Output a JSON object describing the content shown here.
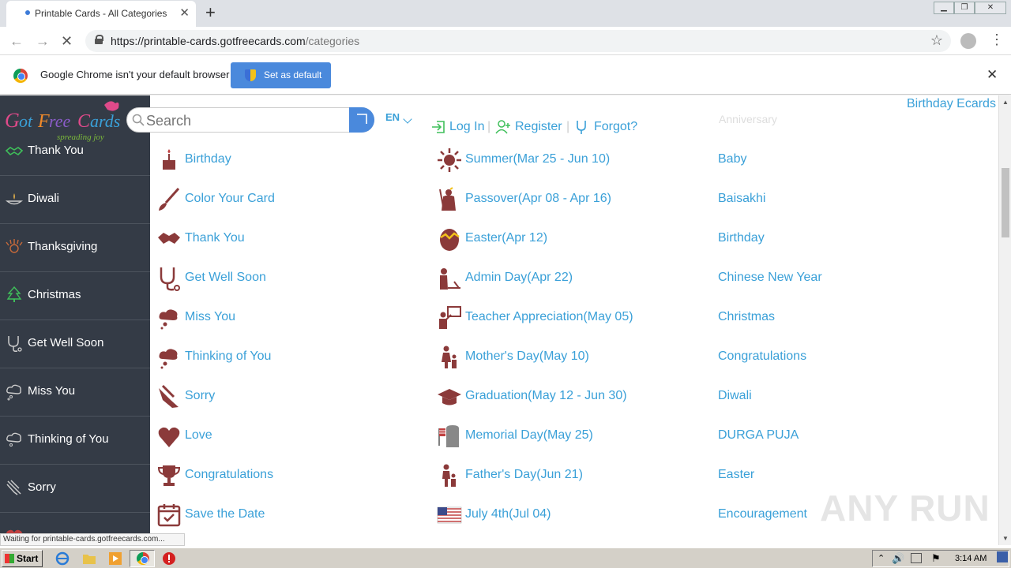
{
  "browser": {
    "tab_title": "Printable Cards - All Categories",
    "url_domain": "https://printable-cards.gotfreecards.com",
    "url_path": "/categories",
    "infobar_text": "Google Chrome isn't your default browser",
    "set_default_label": "Set as default"
  },
  "header": {
    "search_placeholder": "Search",
    "lang": "EN",
    "login": "Log In",
    "register": "Register",
    "forgot": "Forgot?",
    "ecards_link": "Birthday Ecards",
    "faded_top": "Anniversary"
  },
  "sidebar": {
    "items": [
      {
        "label": "Thank You",
        "icon": "handshake-icon"
      },
      {
        "label": "Diwali",
        "icon": "diya-icon"
      },
      {
        "label": "Thanksgiving",
        "icon": "turkey-icon"
      },
      {
        "label": "Christmas",
        "icon": "tree-icon"
      },
      {
        "label": "Get Well Soon",
        "icon": "stethoscope-icon"
      },
      {
        "label": "Miss You",
        "icon": "cloud-icon"
      },
      {
        "label": "Thinking of You",
        "icon": "thought-icon"
      },
      {
        "label": "Sorry",
        "icon": "praying-hands-icon"
      }
    ]
  },
  "col1": [
    {
      "label": "Birthday",
      "icon": "cake-icon"
    },
    {
      "label": "Color Your Card",
      "icon": "brush-icon"
    },
    {
      "label": "Thank You",
      "icon": "handshake-icon"
    },
    {
      "label": "Get Well Soon",
      "icon": "stethoscope-icon"
    },
    {
      "label": "Miss You",
      "icon": "cloud-icon"
    },
    {
      "label": "Thinking of You",
      "icon": "thought-icon"
    },
    {
      "label": "Sorry",
      "icon": "praying-hands-icon"
    },
    {
      "label": "Love",
      "icon": "heart-icon"
    },
    {
      "label": "Congratulations",
      "icon": "trophy-icon"
    },
    {
      "label": "Save the Date",
      "icon": "calendar-icon"
    }
  ],
  "col2": [
    {
      "label": "Summer(Mar 25 - Jun 10)",
      "icon": "sun-icon"
    },
    {
      "label": "Passover(Apr 08 - Apr 16)",
      "icon": "moses-icon"
    },
    {
      "label": "Easter(Apr 12)",
      "icon": "egg-icon"
    },
    {
      "label": "Admin Day(Apr 22)",
      "icon": "admin-icon"
    },
    {
      "label": "Teacher Appreciation(May 05)",
      "icon": "teacher-icon"
    },
    {
      "label": "Mother's Day(May 10)",
      "icon": "mother-icon"
    },
    {
      "label": "Graduation(May 12 - Jun 30)",
      "icon": "graduation-cap-icon"
    },
    {
      "label": "Memorial Day(May 25)",
      "icon": "memorial-icon"
    },
    {
      "label": "Father's Day(Jun 21)",
      "icon": "father-icon"
    },
    {
      "label": "July 4th(Jul 04)",
      "icon": "us-flag-icon"
    }
  ],
  "col3": [
    "Baby",
    "Baisakhi",
    "Birthday",
    "Chinese New Year",
    "Christmas",
    "Congratulations",
    "Diwali",
    "DURGA PUJA",
    "Easter",
    "Encouragement"
  ],
  "status_text": "Waiting for printable-cards.gotfreecards.com...",
  "watermark": "ANY RUN",
  "taskbar": {
    "start": "Start",
    "clock": "3:14 AM"
  },
  "colors": {
    "link": "#3aa0d8",
    "icon": "#8b3a3a",
    "sidebar": "#343b46"
  }
}
